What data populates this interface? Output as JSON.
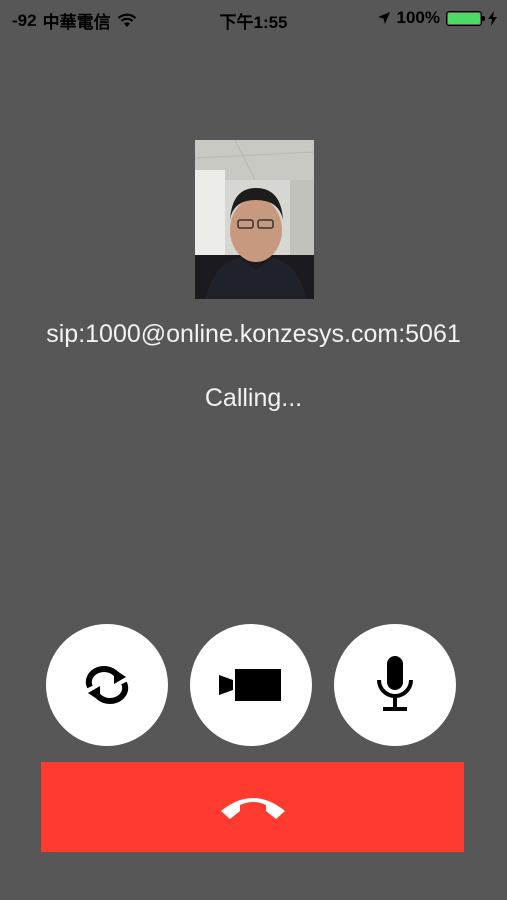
{
  "status_bar": {
    "signal": "-92",
    "carrier": "中華電信",
    "time": "下午1:55",
    "battery": "100%",
    "icons": [
      "wifi-icon",
      "location-arrow-icon",
      "battery-icon",
      "charging-icon"
    ]
  },
  "call": {
    "address": "sip:1000@online.konzesys.com:5061",
    "status": "Calling..."
  },
  "controls": {
    "buttons": [
      "switch-camera-icon",
      "video-camera-icon",
      "microphone-icon"
    ],
    "hangup": "phone-hangup-icon"
  },
  "colors": {
    "background": "#575757",
    "hangup": "#ff3b30",
    "battery": "#4cd964",
    "button": "#ffffff"
  }
}
